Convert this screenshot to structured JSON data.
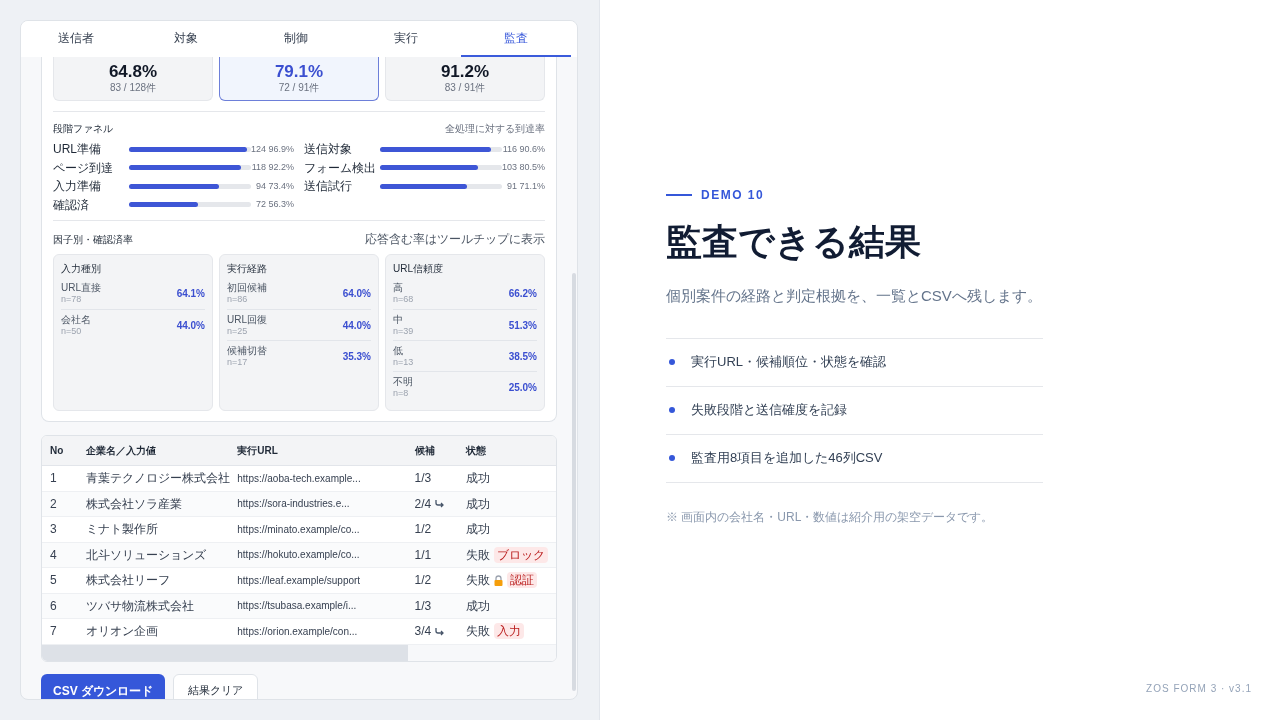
{
  "tabs": [
    {
      "label": "送信者",
      "selected": false
    },
    {
      "label": "対象",
      "selected": false
    },
    {
      "label": "制御",
      "selected": false
    },
    {
      "label": "実行",
      "selected": false
    },
    {
      "label": "監査",
      "selected": true
    }
  ],
  "stats": [
    {
      "value": "64.8%",
      "detail": "83 / 128件",
      "selected": false
    },
    {
      "value": "79.1%",
      "detail": "72 / 91件",
      "selected": true
    },
    {
      "value": "91.2%",
      "detail": "83 / 91件",
      "selected": false
    }
  ],
  "funnel": {
    "title": "段階ファネル",
    "note": "全処理に対する到達率",
    "columns": [
      [
        {
          "label": "URL準備",
          "level": 0.969,
          "reading": "124 96.9%"
        },
        {
          "label": "ページ到達",
          "level": 0.922,
          "reading": "118 92.2%"
        },
        {
          "label": "入力準備",
          "level": 0.734,
          "reading": "94 73.4%"
        },
        {
          "label": "確認済",
          "level": 0.563,
          "reading": "72 56.3%"
        }
      ],
      [
        {
          "label": "送信対象",
          "level": 0.906,
          "reading": "116 90.6%"
        },
        {
          "label": "フォーム検出",
          "level": 0.805,
          "reading": "103 80.5%"
        },
        {
          "label": "送信試行",
          "level": 0.711,
          "reading": "91 71.1%"
        }
      ]
    ]
  },
  "factors": {
    "title": "因子別・確認済率",
    "note": "応答含む率はツールチップに表示",
    "groups": [
      {
        "title": "入力種別",
        "rows": [
          {
            "label": "URL直接",
            "n": "n=78",
            "rate": "64.1%"
          },
          {
            "label": "会社名",
            "n": "n=50",
            "rate": "44.0%"
          }
        ]
      },
      {
        "title": "実行経路",
        "rows": [
          {
            "label": "初回候補",
            "n": "n=86",
            "rate": "64.0%"
          },
          {
            "label": "URL回復",
            "n": "n=25",
            "rate": "44.0%"
          },
          {
            "label": "候補切替",
            "n": "n=17",
            "rate": "35.3%"
          }
        ]
      },
      {
        "title": "URL信頼度",
        "rows": [
          {
            "label": "高",
            "n": "n=68",
            "rate": "66.2%"
          },
          {
            "label": "中",
            "n": "n=39",
            "rate": "51.3%"
          },
          {
            "label": "低",
            "n": "n=13",
            "rate": "38.5%"
          },
          {
            "label": "不明",
            "n": "n=8",
            "rate": "25.0%"
          }
        ]
      }
    ]
  },
  "table": {
    "columns": [
      "No",
      "企業名／入力値",
      "実行URL",
      "候補",
      "状態"
    ],
    "rows": [
      {
        "no": "1",
        "company": "青葉テクノロジー株式会社",
        "url": "https://aoba-tech.example...",
        "candidate": "1/3",
        "rerouted": false,
        "status": "成功",
        "locked": false
      },
      {
        "no": "2",
        "company": "株式会社ソラ産業",
        "url": "https://sora-industries.e...",
        "candidate": "2/4",
        "rerouted": true,
        "status": "成功",
        "locked": false
      },
      {
        "no": "3",
        "company": "ミナト製作所",
        "url": "https://minato.example/co...",
        "candidate": "1/2",
        "rerouted": false,
        "status": "成功",
        "locked": false
      },
      {
        "no": "4",
        "company": "北斗ソリューションズ",
        "url": "https://hokuto.example/co...",
        "candidate": "1/1",
        "rerouted": false,
        "status": "失敗",
        "locked": false,
        "tag": "ブロック"
      },
      {
        "no": "5",
        "company": "株式会社リーフ",
        "url": "https://leaf.example/support",
        "candidate": "1/2",
        "rerouted": false,
        "status": "失敗",
        "locked": true,
        "tag": "認証"
      },
      {
        "no": "6",
        "company": "ツバサ物流株式会社",
        "url": "https://tsubasa.example/i...",
        "candidate": "1/3",
        "rerouted": false,
        "status": "成功",
        "locked": false
      },
      {
        "no": "7",
        "company": "オリオン企画",
        "url": "https://orion.example/con...",
        "candidate": "3/4",
        "rerouted": true,
        "status": "失敗",
        "locked": false,
        "tag": "入力"
      }
    ]
  },
  "buttons": [
    "CSV ダウンロード",
    "結果クリア"
  ],
  "slide": {
    "eyebrow": "DEMO 10",
    "title": "監査できる結果",
    "subtitle": "個別案件の経路と判定根拠を、一覧とCSVへ残します。",
    "points": [
      "実行URL・候補順位・状態を確認",
      "失敗段階と送信確度を記録",
      "監査用8項目を追加した46列CSV"
    ],
    "note": "※ 画面内の会社名・URL・数値は紹介用の架空データです。",
    "footer": "ZOS FORM 3 · v3.1"
  }
}
